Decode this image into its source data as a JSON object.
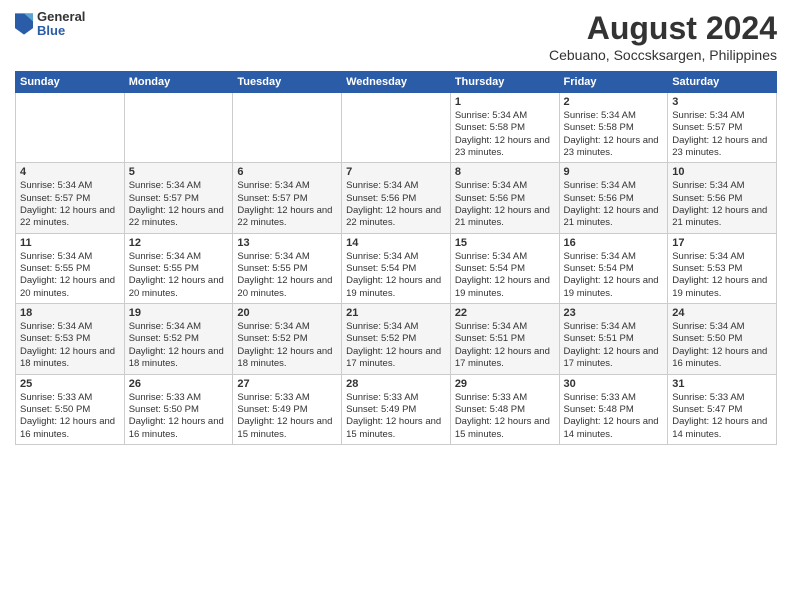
{
  "logo": {
    "general": "General",
    "blue": "Blue"
  },
  "header": {
    "title": "August 2024",
    "subtitle": "Cebuano, Soccsksargen, Philippines"
  },
  "days_of_week": [
    "Sunday",
    "Monday",
    "Tuesday",
    "Wednesday",
    "Thursday",
    "Friday",
    "Saturday"
  ],
  "weeks": [
    {
      "days": [
        {
          "num": "",
          "content": ""
        },
        {
          "num": "",
          "content": ""
        },
        {
          "num": "",
          "content": ""
        },
        {
          "num": "",
          "content": ""
        },
        {
          "num": "1",
          "content": "Sunrise: 5:34 AM\nSunset: 5:58 PM\nDaylight: 12 hours and 23 minutes."
        },
        {
          "num": "2",
          "content": "Sunrise: 5:34 AM\nSunset: 5:58 PM\nDaylight: 12 hours and 23 minutes."
        },
        {
          "num": "3",
          "content": "Sunrise: 5:34 AM\nSunset: 5:57 PM\nDaylight: 12 hours and 23 minutes."
        }
      ]
    },
    {
      "days": [
        {
          "num": "4",
          "content": "Sunrise: 5:34 AM\nSunset: 5:57 PM\nDaylight: 12 hours and 22 minutes."
        },
        {
          "num": "5",
          "content": "Sunrise: 5:34 AM\nSunset: 5:57 PM\nDaylight: 12 hours and 22 minutes."
        },
        {
          "num": "6",
          "content": "Sunrise: 5:34 AM\nSunset: 5:57 PM\nDaylight: 12 hours and 22 minutes."
        },
        {
          "num": "7",
          "content": "Sunrise: 5:34 AM\nSunset: 5:56 PM\nDaylight: 12 hours and 22 minutes."
        },
        {
          "num": "8",
          "content": "Sunrise: 5:34 AM\nSunset: 5:56 PM\nDaylight: 12 hours and 21 minutes."
        },
        {
          "num": "9",
          "content": "Sunrise: 5:34 AM\nSunset: 5:56 PM\nDaylight: 12 hours and 21 minutes."
        },
        {
          "num": "10",
          "content": "Sunrise: 5:34 AM\nSunset: 5:56 PM\nDaylight: 12 hours and 21 minutes."
        }
      ]
    },
    {
      "days": [
        {
          "num": "11",
          "content": "Sunrise: 5:34 AM\nSunset: 5:55 PM\nDaylight: 12 hours and 20 minutes."
        },
        {
          "num": "12",
          "content": "Sunrise: 5:34 AM\nSunset: 5:55 PM\nDaylight: 12 hours and 20 minutes."
        },
        {
          "num": "13",
          "content": "Sunrise: 5:34 AM\nSunset: 5:55 PM\nDaylight: 12 hours and 20 minutes."
        },
        {
          "num": "14",
          "content": "Sunrise: 5:34 AM\nSunset: 5:54 PM\nDaylight: 12 hours and 19 minutes."
        },
        {
          "num": "15",
          "content": "Sunrise: 5:34 AM\nSunset: 5:54 PM\nDaylight: 12 hours and 19 minutes."
        },
        {
          "num": "16",
          "content": "Sunrise: 5:34 AM\nSunset: 5:54 PM\nDaylight: 12 hours and 19 minutes."
        },
        {
          "num": "17",
          "content": "Sunrise: 5:34 AM\nSunset: 5:53 PM\nDaylight: 12 hours and 19 minutes."
        }
      ]
    },
    {
      "days": [
        {
          "num": "18",
          "content": "Sunrise: 5:34 AM\nSunset: 5:53 PM\nDaylight: 12 hours and 18 minutes."
        },
        {
          "num": "19",
          "content": "Sunrise: 5:34 AM\nSunset: 5:52 PM\nDaylight: 12 hours and 18 minutes."
        },
        {
          "num": "20",
          "content": "Sunrise: 5:34 AM\nSunset: 5:52 PM\nDaylight: 12 hours and 18 minutes."
        },
        {
          "num": "21",
          "content": "Sunrise: 5:34 AM\nSunset: 5:52 PM\nDaylight: 12 hours and 17 minutes."
        },
        {
          "num": "22",
          "content": "Sunrise: 5:34 AM\nSunset: 5:51 PM\nDaylight: 12 hours and 17 minutes."
        },
        {
          "num": "23",
          "content": "Sunrise: 5:34 AM\nSunset: 5:51 PM\nDaylight: 12 hours and 17 minutes."
        },
        {
          "num": "24",
          "content": "Sunrise: 5:34 AM\nSunset: 5:50 PM\nDaylight: 12 hours and 16 minutes."
        }
      ]
    },
    {
      "days": [
        {
          "num": "25",
          "content": "Sunrise: 5:33 AM\nSunset: 5:50 PM\nDaylight: 12 hours and 16 minutes."
        },
        {
          "num": "26",
          "content": "Sunrise: 5:33 AM\nSunset: 5:50 PM\nDaylight: 12 hours and 16 minutes."
        },
        {
          "num": "27",
          "content": "Sunrise: 5:33 AM\nSunset: 5:49 PM\nDaylight: 12 hours and 15 minutes."
        },
        {
          "num": "28",
          "content": "Sunrise: 5:33 AM\nSunset: 5:49 PM\nDaylight: 12 hours and 15 minutes."
        },
        {
          "num": "29",
          "content": "Sunrise: 5:33 AM\nSunset: 5:48 PM\nDaylight: 12 hours and 15 minutes."
        },
        {
          "num": "30",
          "content": "Sunrise: 5:33 AM\nSunset: 5:48 PM\nDaylight: 12 hours and 14 minutes."
        },
        {
          "num": "31",
          "content": "Sunrise: 5:33 AM\nSunset: 5:47 PM\nDaylight: 12 hours and 14 minutes."
        }
      ]
    }
  ]
}
